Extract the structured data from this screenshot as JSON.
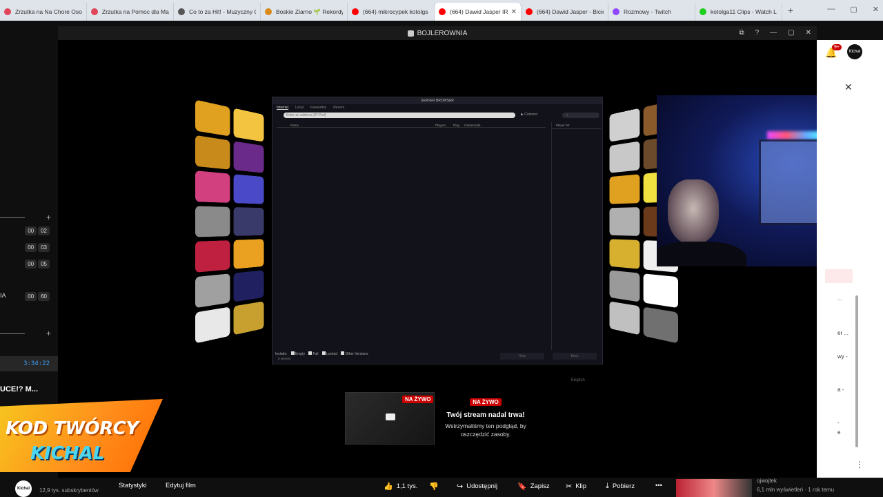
{
  "browser": {
    "tabs": [
      {
        "label": "Zrzutka na Na Chore Osoł",
        "color": "#e0455a"
      },
      {
        "label": "Zrzutka na Pomoc dla Ma",
        "color": "#e0455a"
      },
      {
        "label": "Co to za Hit! - Muzyczny Q",
        "color": "#555"
      },
      {
        "label": "Boskie Ziarno 🌱 Rekordy",
        "color": "#d88a1a"
      },
      {
        "label": "(664) mikrocypek kotolgs",
        "color": "#ff0000"
      },
      {
        "label": "(664) Dawid Jasper IR",
        "color": "#ff0000"
      },
      {
        "label": "(664) Dawid Jasper - Bicie",
        "color": "#ff0000"
      },
      {
        "label": "Rozmowy - Twitch",
        "color": "#9146ff"
      },
      {
        "label": "kotolga11 Clips - Watch L",
        "color": "#1fd11f"
      }
    ],
    "new_tab": "+",
    "controls": [
      "—",
      "▢",
      "✕"
    ]
  },
  "game_window": {
    "title": "BOJLEROWNIA",
    "controls": [
      "⧉",
      "?",
      "—",
      "▢",
      "✕"
    ]
  },
  "server_browser": {
    "title": "SERVER BROWSER",
    "tabs": [
      "Internet",
      "Local",
      "Favourites",
      "Recent"
    ],
    "address_placeholder": "Enter an address [IP:Port]",
    "connect": "▶ Connect",
    "columns": [
      "Name",
      "Players",
      "Ping",
      "Gamemode"
    ],
    "player_list": "Player list",
    "include_label": "Include:",
    "filters": [
      "Empty",
      "Full",
      "Locked",
      "Other Versions"
    ],
    "count": "0 servers",
    "help": "Help",
    "back": "Back",
    "language": "English"
  },
  "left_chat": {
    "rows": [
      {
        "pills": [
          "00",
          "02"
        ]
      },
      {
        "pills": [
          "00",
          "03"
        ]
      },
      {
        "pills": [
          "00",
          "05"
        ]
      },
      {
        "prefix": "IA",
        "pills": [
          "00",
          "60"
        ]
      }
    ],
    "duration": "3:34:22",
    "title_snippet": "UCE!? M...",
    "plus": "+"
  },
  "stream_card": {
    "badge": "NA ŻYWO",
    "heading": "Twój stream nadal trwa!",
    "body": "Wstrzymaliśmy ten podgląd, by oszczędzić zasoby."
  },
  "creator_code": {
    "line1": "KOD TWÓRCY",
    "line2": "KICHAL"
  },
  "right_sidebar": {
    "notif_count": "9+",
    "avatar": "Kichal",
    "items": [
      "...",
      "er ...",
      "wy -",
      "a -",
      "-",
      "e"
    ]
  },
  "bottom_bar": {
    "avatar": "Kichal",
    "subscribers": "12,9 tys. subskrybentów",
    "stats": "Statystyki",
    "edit": "Edytuj film",
    "likes": "1,1 tys.",
    "share": "Udostępnij",
    "save": "Zapisz",
    "clip": "Klip",
    "download": "Pobierz",
    "more": "•••",
    "rec_channel": "ojwojtek",
    "rec_meta": "6,1 mln wyświetleń · 1 rok temu"
  }
}
